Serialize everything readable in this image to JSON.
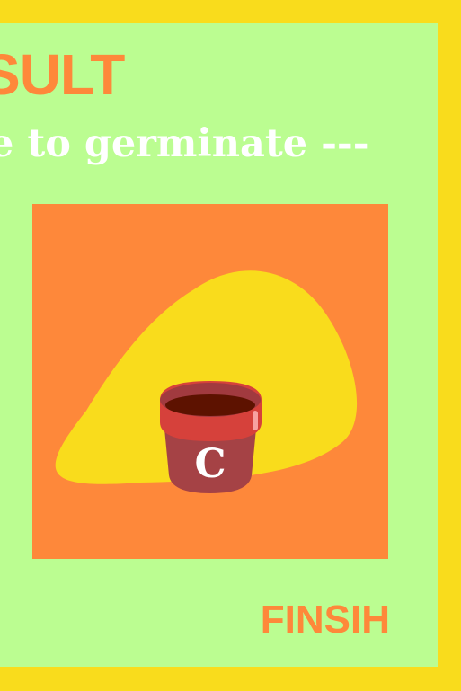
{
  "screen": {
    "title": "SULT",
    "subtitle": "e to germinate ---",
    "finish_label": "FINSIH"
  },
  "result_card": {
    "pot_label": "C"
  },
  "colors": {
    "frame": "#f9dc1c",
    "background": "#bbfd91",
    "accent": "#fe883a",
    "blob": "#f9dc1c",
    "pot": "#a54245",
    "pot_rim": "#d6413b",
    "soil": "#5d1200",
    "text_light": "#ffffff"
  },
  "icons": {
    "pot": "flower-pot-icon"
  }
}
